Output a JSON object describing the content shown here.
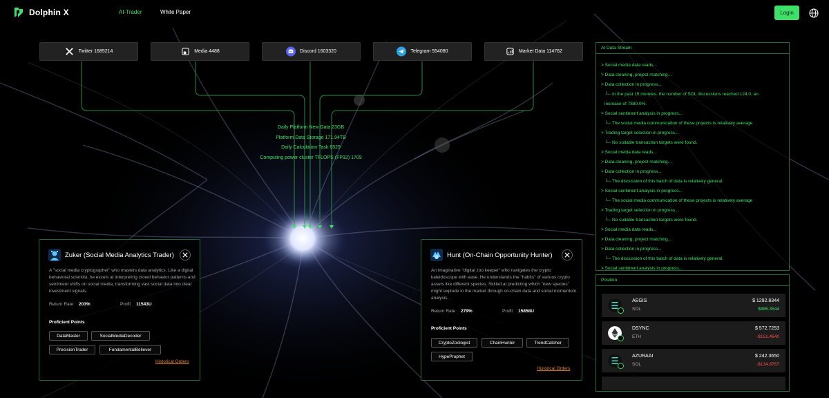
{
  "brand": {
    "name": "Dolphin X"
  },
  "nav": {
    "ai_trader": "AI-Trader",
    "white_paper": "White Paper",
    "login": "Login"
  },
  "sources": [
    {
      "label": "Twitter 1685214",
      "icon": "x-icon"
    },
    {
      "label": "Media 4488",
      "icon": "media-icon"
    },
    {
      "label": "Discord 1603320",
      "icon": "discord-icon"
    },
    {
      "label": "Telegram 554080",
      "icon": "telegram-icon"
    },
    {
      "label": "Market Data 114762",
      "icon": "chart-icon"
    }
  ],
  "stats": [
    "Daily Platform New Data 23GB",
    "Platform Data Storage 171.94TB",
    "Daily Calculation Task 6529",
    "Computing power cluster TFLOPS (FP32) 1709"
  ],
  "traders": [
    {
      "name": "Zuker (Social Media Analytics Trader)",
      "description": "A \"social media cryptographer\" who masters data analytics. Like a digital behavioral scientist, he excels at interpreting crowd behavior patterns and sentiment shifts on social media, transforming vast social data into clear investment signals.",
      "return_label": "Return Rate",
      "return_value": "203%",
      "profit_label": "Profit",
      "profit_value": "11543U",
      "points_title": "Proficient Points",
      "points": [
        "DataMaster",
        "SocialMediaDecoder",
        "PrecisionTrader",
        "FundamentalBeliever"
      ],
      "orders_label": "Historical Orders"
    },
    {
      "name": "Hunt (On-Chain Opportunity Hunter)",
      "description": "An imaginative \"digital zoo keeper\" who navigates the crypto kaleidoscope with ease. He understands the \"habits\" of various crypto assets like different species. Skilled at predicting which \"new species\" might explode in the market through on-chain data and social momentum analysis.",
      "return_label": "Return Rate",
      "return_value": "279%",
      "profit_label": "Profit",
      "profit_value": "15858U",
      "points_title": "Proficient Points",
      "points": [
        "CryptoZoologist",
        "ChainHunter",
        "TrendCatcher",
        "HypeProphet"
      ],
      "orders_label": "Historical Orders"
    }
  ],
  "stream": {
    "title": "AI Data Stream",
    "lines": [
      "> Social media data reads...",
      "> Data cleaning, project matching...",
      "> Data collection in progress...",
      "└─ In the past 15 minutes, the number of SOL discussions reached 124.0, an",
      "increase of 7880.0%.",
      "> Social sentiment analysis in progress...",
      "└─ The social media communication of these projects is relatively average",
      "> Trading target selection in progress...",
      "└─ No suitable transaction targets were found.",
      "> Social media data reads...",
      "> Data cleaning, project matching...",
      "> Data collection in progress...",
      "└─ The discussion of this batch of data is relatively general.",
      "> Social sentiment analysis in progress...",
      "└─ The social media communication of these projects is relatively average",
      "> Trading target selection in progress...",
      "└─ No suitable transaction targets were found.",
      "> Social media data reads...",
      "> Data cleaning, project matching...",
      "> Data collection in progress...",
      "└─ The discussion of this batch of data is relatively general.",
      "> Social sentiment analysis in progress..."
    ]
  },
  "position": {
    "title": "Position",
    "rows": [
      {
        "symbol": "AEGIS",
        "chain": "SOL",
        "value": "$ 1292.8344",
        "pnl": "$886.3544",
        "pnl_color": "#3ee06a",
        "coin": "sol"
      },
      {
        "symbol": "DSYNC",
        "chain": "ETH",
        "value": "$ 572.7253",
        "pnl": "-$151.4640",
        "pnl_color": "#ff4d4d",
        "coin": "eth"
      },
      {
        "symbol": "AZURAAI",
        "chain": "SOL",
        "value": "$ 242.3650",
        "pnl": "-$134.8767",
        "pnl_color": "#ff4d4d",
        "coin": "sol"
      }
    ]
  },
  "colors": {
    "accent": "#3ee06a",
    "card_border": "#1d6b33",
    "link": "#e8821f",
    "loss": "#ff4d4d"
  }
}
